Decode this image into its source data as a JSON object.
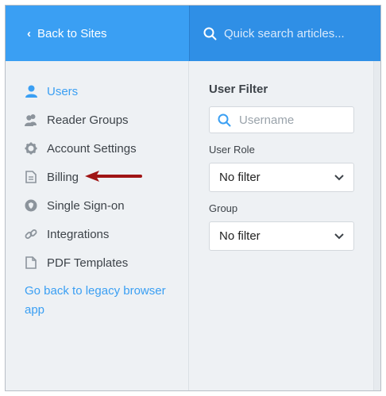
{
  "topbar": {
    "back_label": "Back to Sites",
    "search_placeholder": "Quick search articles..."
  },
  "sidebar": {
    "items": [
      {
        "label": "Users",
        "icon": "user-icon",
        "active": true
      },
      {
        "label": "Reader Groups",
        "icon": "reader-groups-icon",
        "active": false
      },
      {
        "label": "Account Settings",
        "icon": "gear-icon",
        "active": false
      },
      {
        "label": "Billing",
        "icon": "document-icon",
        "active": false
      },
      {
        "label": "Single Sign-on",
        "icon": "shield-icon",
        "active": false
      },
      {
        "label": "Integrations",
        "icon": "link-icon",
        "active": false
      },
      {
        "label": "PDF Templates",
        "icon": "file-icon",
        "active": false
      }
    ],
    "legacy_link": "Go back to legacy browser app"
  },
  "filter": {
    "title": "User Filter",
    "username_placeholder": "Username",
    "role_label": "User Role",
    "role_value": "No filter",
    "group_label": "Group",
    "group_value": "No filter"
  },
  "colors": {
    "accent": "#3a9ff3",
    "header_search_bg": "#2f8fe6",
    "arrow": "#a01515"
  }
}
